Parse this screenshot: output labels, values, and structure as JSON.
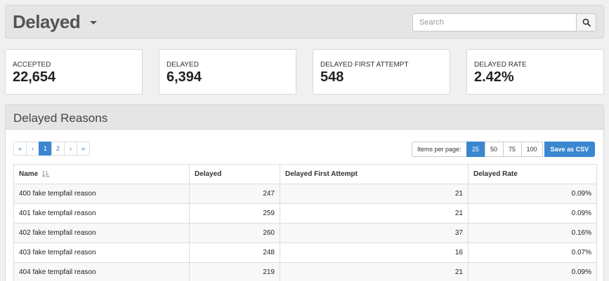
{
  "header": {
    "title": "Delayed",
    "search_placeholder": "Search",
    "search_value": "",
    "icons": [
      "chevron-down-icon",
      "search-icon"
    ]
  },
  "stats": [
    {
      "label": "ACCEPTED",
      "value": "22,654"
    },
    {
      "label": "DELAYED",
      "value": "6,394"
    },
    {
      "label": "DELAYED FIRST ATTEMPT",
      "value": "548"
    },
    {
      "label": "DELAYED RATE",
      "value": "2.42%"
    }
  ],
  "panel": {
    "title": "Delayed Reasons",
    "pagination": {
      "first": "«",
      "prev": "‹",
      "pages": [
        "1",
        "2"
      ],
      "active_page": "1",
      "next": "›",
      "last": "»"
    },
    "items_per_page": {
      "label": "Items per page:",
      "options": [
        "25",
        "50",
        "75",
        "100"
      ],
      "selected": "25"
    },
    "csv_button": "Save as CSV",
    "table": {
      "columns": [
        "Name",
        "Delayed",
        "Delayed First Attempt",
        "Delayed Rate"
      ],
      "sort_icon": "sort-ascending-icon",
      "rows": [
        [
          "400 fake tempfail reason",
          "247",
          "21",
          "0.09%"
        ],
        [
          "401 fake tempfail reason",
          "259",
          "21",
          "0.09%"
        ],
        [
          "402 fake tempfail reason",
          "260",
          "37",
          "0.16%"
        ],
        [
          "403 fake tempfail reason",
          "248",
          "16",
          "0.07%"
        ],
        [
          "404 fake tempfail reason",
          "219",
          "21",
          "0.09%"
        ]
      ]
    }
  },
  "colors": {
    "accent": "#3a87d0",
    "header_bg": "#e5e5e5",
    "page_bg": "#f0f0f0"
  }
}
